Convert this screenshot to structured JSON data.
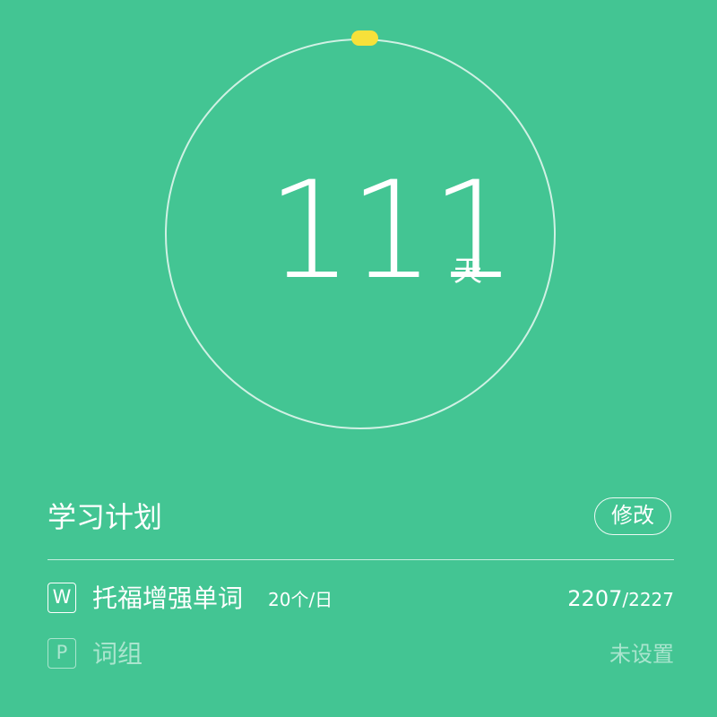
{
  "progress": {
    "days": "111",
    "unit": "天"
  },
  "plan": {
    "title": "学习计划",
    "edit_label": "修改",
    "items": [
      {
        "badge": "W",
        "name": "托福增强单词",
        "rate": "20个/日",
        "learned": "2207",
        "total": "/2227"
      },
      {
        "badge": "P",
        "name": "词组",
        "status": "未设置"
      }
    ]
  },
  "colors": {
    "background": "#43c593",
    "ring_marker": "#f7e13a"
  }
}
